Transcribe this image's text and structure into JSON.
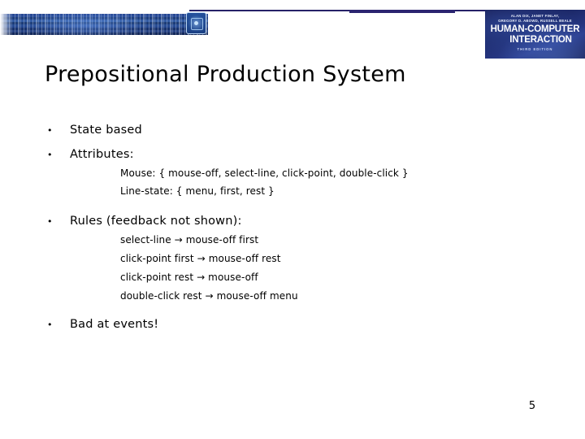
{
  "header": {
    "badge_icon": "binary-chip-icon",
    "book_cover": {
      "authors_line_1": "ALAN DIX, JANET FINLAY,",
      "authors_line_2": "GREGORY D. ABOWD, RUSSELL BEALE",
      "title_line_1": "HUMAN-COMPUTER",
      "title_line_2": "INTERACTION",
      "edition": "THIRD EDITION"
    }
  },
  "slide": {
    "title": "Prepositional Production System",
    "page_number": "5",
    "bullet_marker": "•",
    "arrow": "→",
    "bullets": [
      {
        "label": "State based"
      },
      {
        "label": "Attributes:"
      },
      {
        "label": "Rules (feedback not shown):"
      },
      {
        "label": "Bad at events!"
      }
    ],
    "attributes": [
      "Mouse: { mouse-off, select-line, click-point, double-click }",
      "Line-state: { menu, first, rest }"
    ],
    "rules": [
      {
        "lhs": "select-line",
        "rhs": "mouse-off first"
      },
      {
        "lhs": "click-point first",
        "rhs": "mouse-off rest"
      },
      {
        "lhs": "click-point rest",
        "rhs": "mouse-off"
      },
      {
        "lhs": "double-click rest",
        "rhs": "mouse-off menu"
      }
    ]
  },
  "colors": {
    "rule_navy": "#262168",
    "strip_blue": "#1d3f8f",
    "text_black": "#000000"
  }
}
